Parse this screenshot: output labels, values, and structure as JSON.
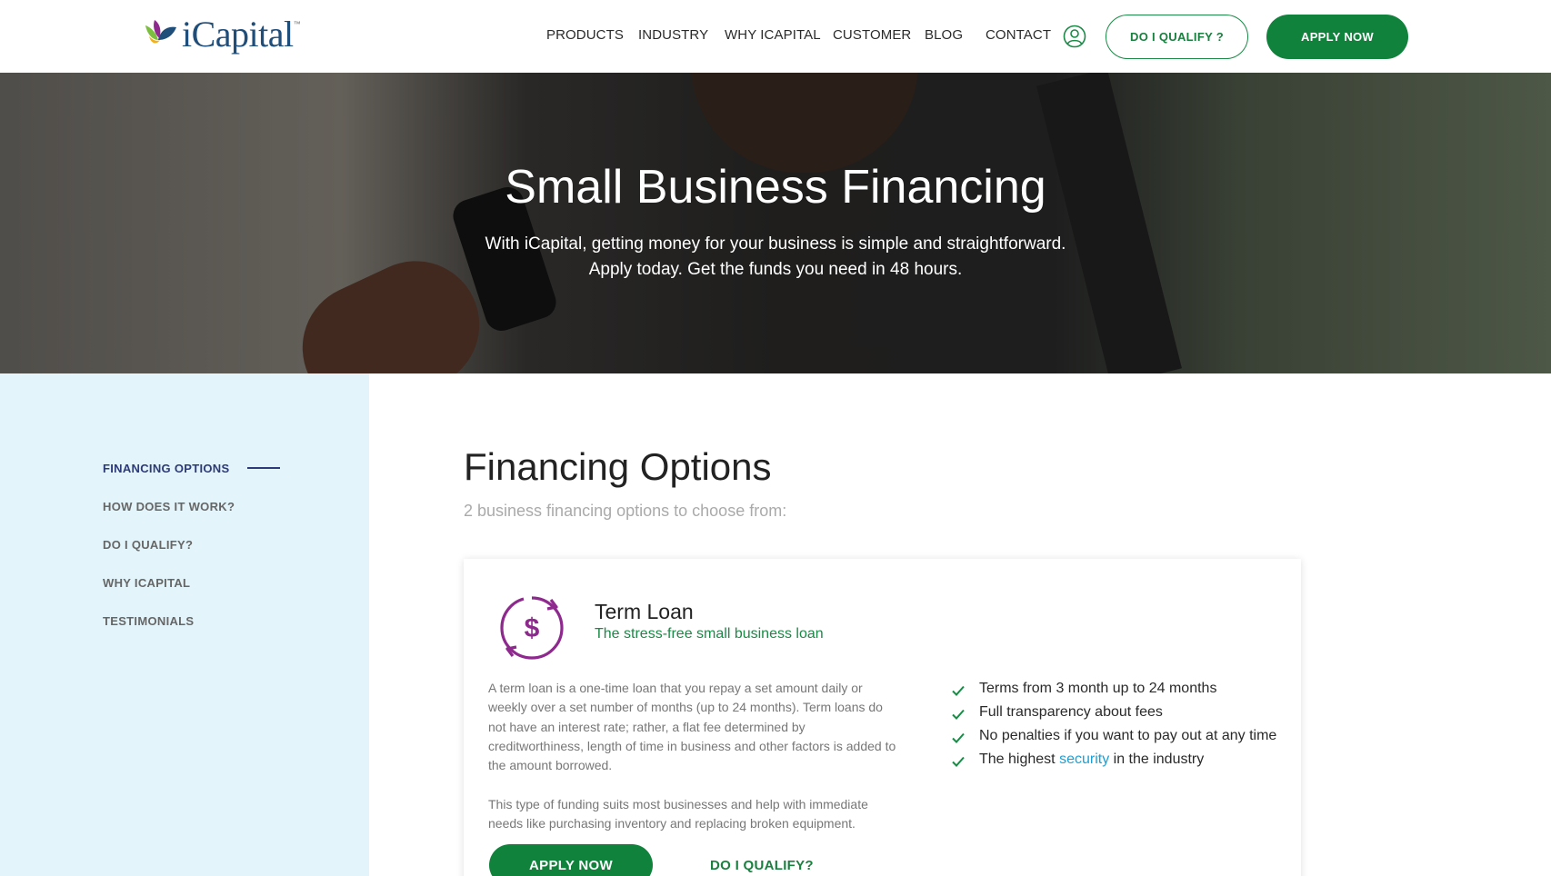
{
  "brand": {
    "name": "iCapital",
    "tm": "™"
  },
  "nav": {
    "items": [
      "PRODUCTS",
      "INDUSTRY",
      "WHY ICAPITAL",
      "CUSTOMER",
      "BLOG",
      "CONTACT"
    ],
    "qualify_label": "DO I QUALIFY ?",
    "apply_label": "APPLY NOW"
  },
  "hero": {
    "title": "Small Business Financing",
    "line1": "With iCapital, getting money for your business is simple and straightforward.",
    "line2": "Apply today. Get the funds you need in 48 hours."
  },
  "sidebar": {
    "items": [
      {
        "label": "FINANCING OPTIONS",
        "active": true
      },
      {
        "label": "HOW DOES IT WORK?",
        "active": false
      },
      {
        "label": "DO I QUALIFY?",
        "active": false
      },
      {
        "label": "WHY ICAPITAL",
        "active": false
      },
      {
        "label": "TESTIMONIALS",
        "active": false
      }
    ]
  },
  "main": {
    "title": "Financing Options",
    "subtitle": "2 business financing options to choose from:"
  },
  "card": {
    "icon": "dollar-cycle-icon",
    "title": "Term Loan",
    "tagline": "The stress-free small business loan",
    "description": "A term loan is a one-time loan that you repay a set amount daily or weekly over a set number of months (up to 24 months). Term loans do not have an interest rate; rather, a flat fee determined by creditworthiness, length of time in business and other factors is added to the amount borrowed.",
    "description2": "This type of funding suits most businesses and help with immediate needs like purchasing inventory and replacing broken equipment.",
    "features": [
      "Terms from 3 month up to 24 months",
      "Full transparency about fees",
      "No penalties if you want to pay out at any time"
    ],
    "feature4_pre": "The highest ",
    "feature4_link": "security",
    "feature4_post": " in the industry",
    "apply_label": "APPLY NOW",
    "qualify_label": "DO I QUALIFY?"
  },
  "colors": {
    "brand_green": "#10823c",
    "sidebar_bg": "#e3f4fa",
    "active_nav": "#2d3a7a",
    "icon_purple": "#8e2a8e",
    "link_blue": "#1aa0d6"
  }
}
